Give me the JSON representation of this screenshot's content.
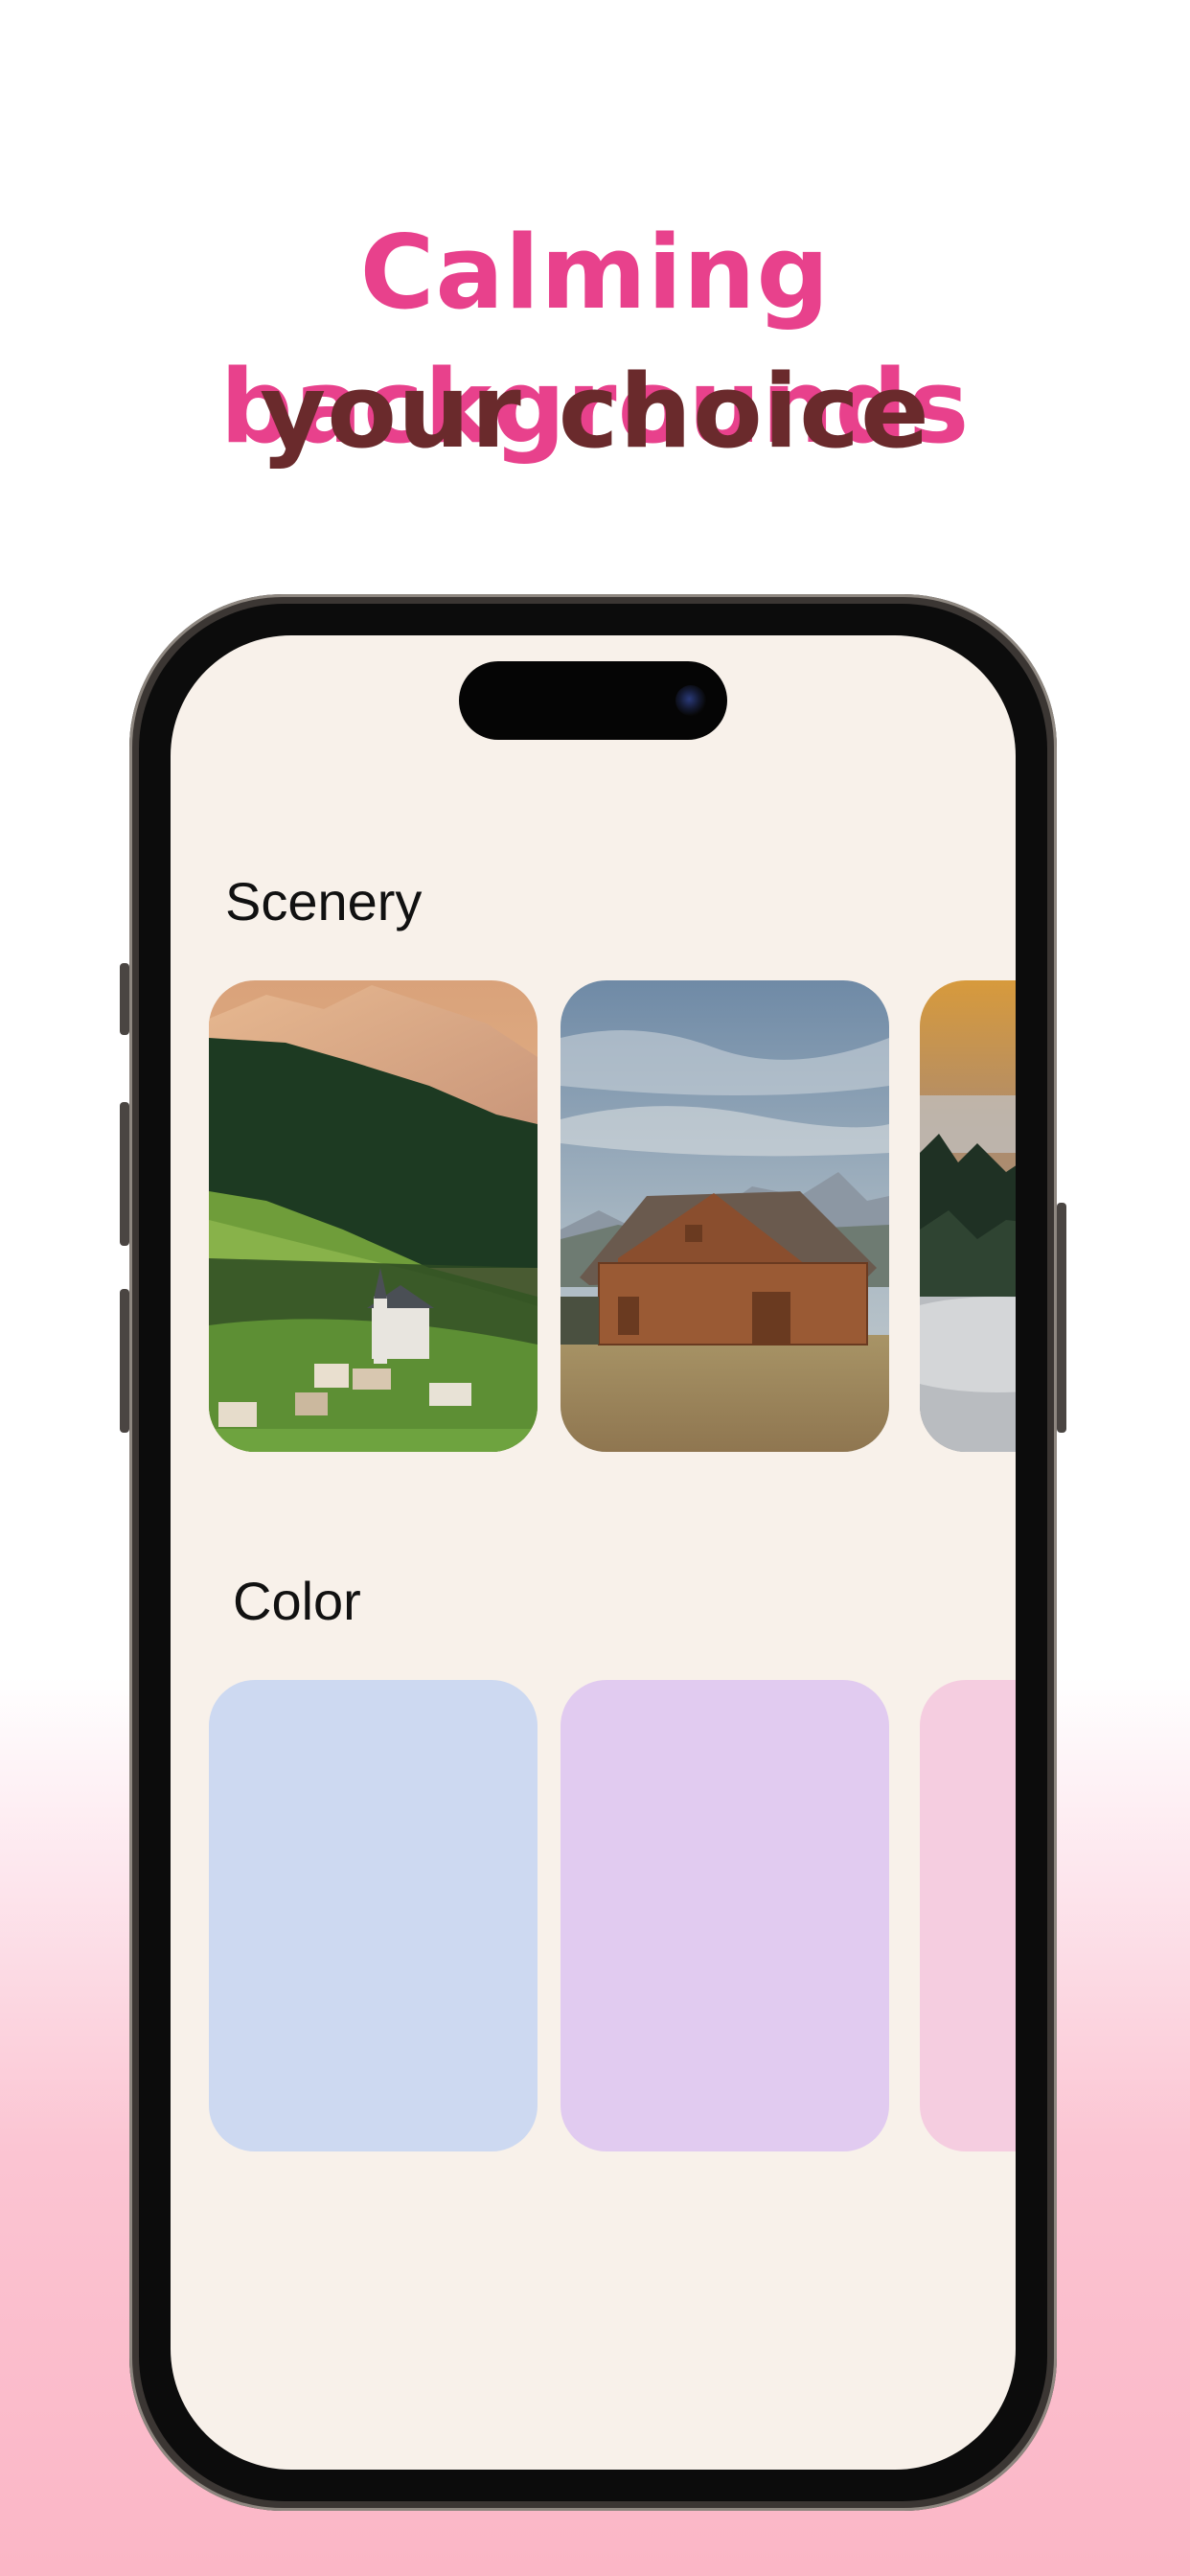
{
  "headline": {
    "line1": "Calming backgrounds",
    "line2": "your choice"
  },
  "sections": {
    "scenery": {
      "title": "Scenery",
      "items": [
        "alpine-village-church",
        "wooden-barn-mountains",
        "misty-forest-sunset"
      ]
    },
    "color": {
      "title": "Color",
      "swatches": [
        "#cdd9f1",
        "#e1cbf0",
        "#f5cde0"
      ]
    }
  },
  "colors": {
    "headline_accent": "#e8418c",
    "headline_dark": "#6a2a2c",
    "screen_background": "#f8f1ea"
  }
}
